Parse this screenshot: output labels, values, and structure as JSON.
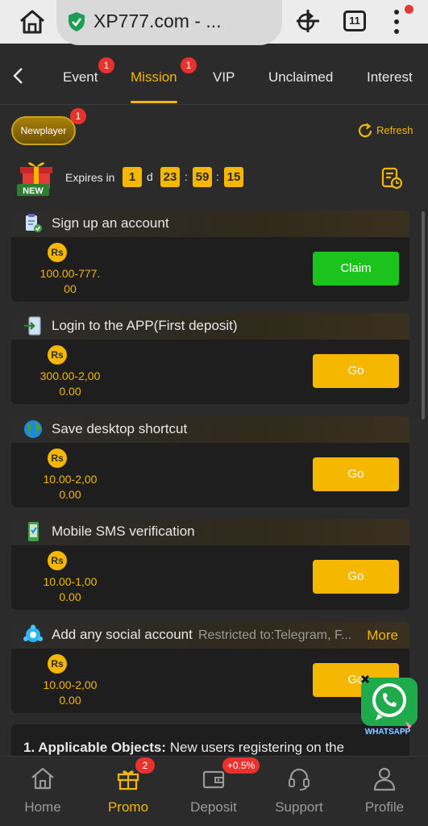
{
  "browser": {
    "url_display": "XP777.com - ...",
    "tab_count": "11"
  },
  "nav": {
    "tabs": [
      {
        "label": "Event",
        "badge": "1"
      },
      {
        "label": "Mission",
        "badge": "1",
        "active": true
      },
      {
        "label": "VIP"
      },
      {
        "label": "Unclaimed"
      },
      {
        "label": "Interest"
      }
    ]
  },
  "mission": {
    "category_label": "Newplayer",
    "category_badge": "1",
    "refresh_label": "Refresh",
    "gift_badge_text": "NEW",
    "expires_label": "Expires in",
    "countdown": {
      "days": "1",
      "day_unit": "d",
      "hours": "23",
      "minutes": "59",
      "seconds": "15",
      "separator": ":"
    },
    "currency_symbol": "Rs",
    "tasks": [
      {
        "title": "Sign up an account",
        "reward_line1": "100.00-777.",
        "reward_line2": "00",
        "action": "Claim",
        "icon": "clipboard-check-icon"
      },
      {
        "title": "Login to the APP(First deposit)",
        "reward_line1": "300.00-2,00",
        "reward_line2": "0.00",
        "action": "Go",
        "icon": "phone-login-icon"
      },
      {
        "title": "Save desktop shortcut",
        "reward_line1": "10.00-2,00",
        "reward_line2": "0.00",
        "action": "Go",
        "icon": "globe-icon"
      },
      {
        "title": "Mobile SMS verification",
        "reward_line1": "10.00-1,00",
        "reward_line2": "0.00",
        "action": "Go",
        "icon": "mobile-sms-icon"
      },
      {
        "title": "Add any social account",
        "subtitle": "Restricted to:Telegram, F...",
        "more": "More",
        "reward_line1": "10.00-2,00",
        "reward_line2": "0.00",
        "action": "Go",
        "icon": "social-icon"
      }
    ]
  },
  "rules": {
    "heading": "1. Applicable Objects:",
    "text": " New users registering on the"
  },
  "whatsapp": {
    "label": "WHATSAPP"
  },
  "bottom_nav": {
    "items": [
      {
        "label": "Home"
      },
      {
        "label": "Promo",
        "badge": "2",
        "active": true
      },
      {
        "label": "Deposit",
        "badge": "+0.5%"
      },
      {
        "label": "Support"
      },
      {
        "label": "Profile"
      }
    ]
  },
  "colors": {
    "accent": "#f5b700",
    "claim": "#1cc31c",
    "badge": "#e8322e",
    "background": "#2b2b2b",
    "card": "#1e1e1e"
  }
}
